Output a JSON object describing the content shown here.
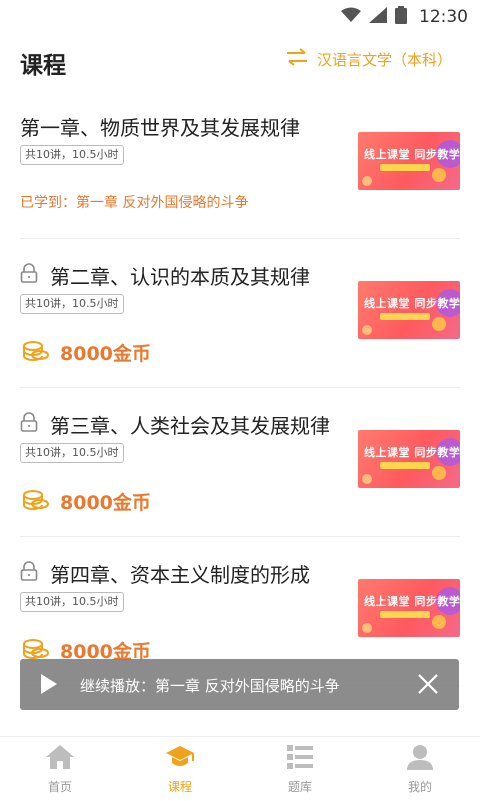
{
  "status_bar": {
    "time": "12:30"
  },
  "header": {
    "title": "课程",
    "major": "汉语言文学（本科）"
  },
  "thumbnail_text": "线上课堂 同步教学",
  "courses": [
    {
      "title": "第一章、物质世界及其发展规律",
      "meta": "共10讲，10.5小时",
      "locked": false,
      "progress": "已学到：第一章 反对外国侵略的斗争"
    },
    {
      "title": "第二章、认识的本质及其规律",
      "meta": "共10讲，10.5小时",
      "locked": true,
      "price": "8000金币"
    },
    {
      "title": "第三章、人类社会及其发展规律",
      "meta": "共10讲，10.5小时",
      "locked": true,
      "price": "8000金币"
    },
    {
      "title": "第四章、资本主义制度的形成",
      "meta": "共10讲，10.5小时",
      "locked": true,
      "price": "8000金币"
    }
  ],
  "toast": {
    "text": "继续播放：第一章 反对外国侵略的斗争"
  },
  "nav": [
    {
      "label": "首页",
      "icon": "home-icon",
      "active": false
    },
    {
      "label": "课程",
      "icon": "graduation-cap-icon",
      "active": true
    },
    {
      "label": "题库",
      "icon": "question-bank-icon",
      "active": false
    },
    {
      "label": "我的",
      "icon": "person-icon",
      "active": false
    }
  ],
  "colors": {
    "accent": "#F0A21C",
    "price": "#E8792E",
    "inactive": "#BDBDBD"
  }
}
